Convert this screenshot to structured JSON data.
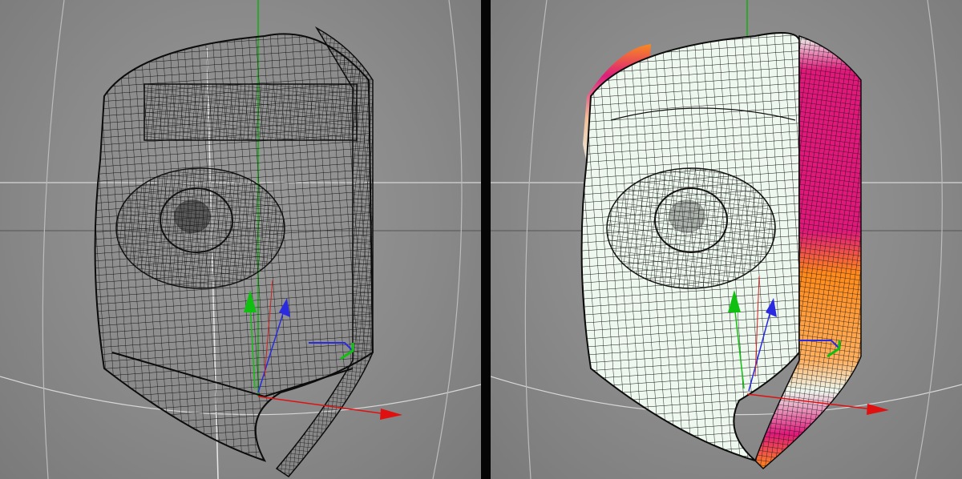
{
  "viewports": [
    {
      "id": "left",
      "shading": "wireframe",
      "mesh_color": "#1a1a1a",
      "face_fill": "none"
    },
    {
      "id": "right",
      "shading": "shaded-wireframe-with-weight-map",
      "mesh_color": "#111111",
      "face_fill": "#eef8ef",
      "weight_colors": {
        "high": "#e0187a",
        "mid": "#ff8a1a",
        "low": "#f6c39a"
      }
    }
  ],
  "scene": {
    "background": "#8e8e8e",
    "grid_color": "#d8d8d8",
    "axes": {
      "x_color": "#e01010",
      "y_color": "#10c010",
      "z_color": "#2020e0"
    }
  }
}
